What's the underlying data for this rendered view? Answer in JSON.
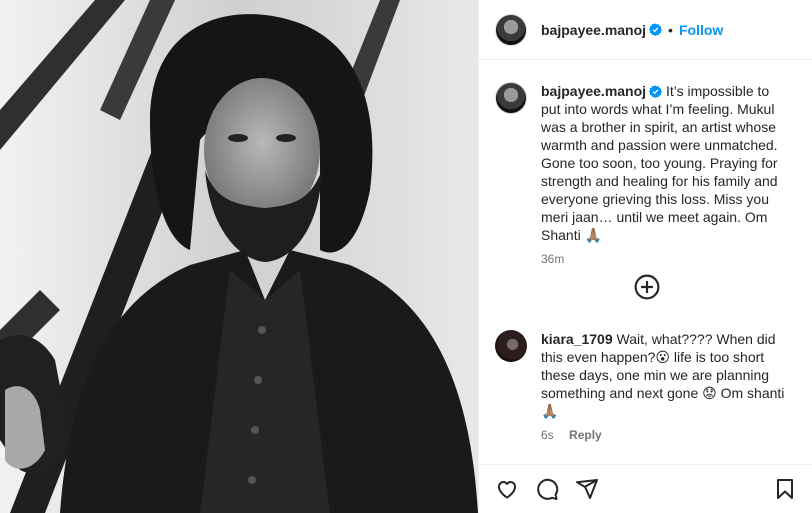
{
  "post": {
    "username": "bajpayee.manoj",
    "follow_label": "Follow",
    "separator": "•"
  },
  "caption": {
    "username": "bajpayee.manoj",
    "text": "It’s impossible to put into words what I’m feeling. Mukul was a brother in spirit, an artist whose warmth and passion were unmatched. Gone too soon, too young. Praying for strength and healing for his family and everyone grieving this loss. Miss you meri jaan… until we meet again. Om Shanti 🙏🏽",
    "time": "36m"
  },
  "comment": {
    "username": "kiara_1709",
    "text": "Wait, what???? When did this even happen?😮 life is too short these days, one min we are planning something and next gone 😟 Om shanti 🙏🏽",
    "time": "6s",
    "reply_label": "Reply"
  },
  "icons": {
    "verified": "verified-badge-icon",
    "load_more": "plus-circle-icon",
    "like": "heart-icon",
    "comment": "comment-icon",
    "share": "share-icon",
    "save": "bookmark-icon"
  },
  "colors": {
    "accent": "#0095f6",
    "text": "#262626",
    "muted": "#737373",
    "border": "#efefef"
  }
}
